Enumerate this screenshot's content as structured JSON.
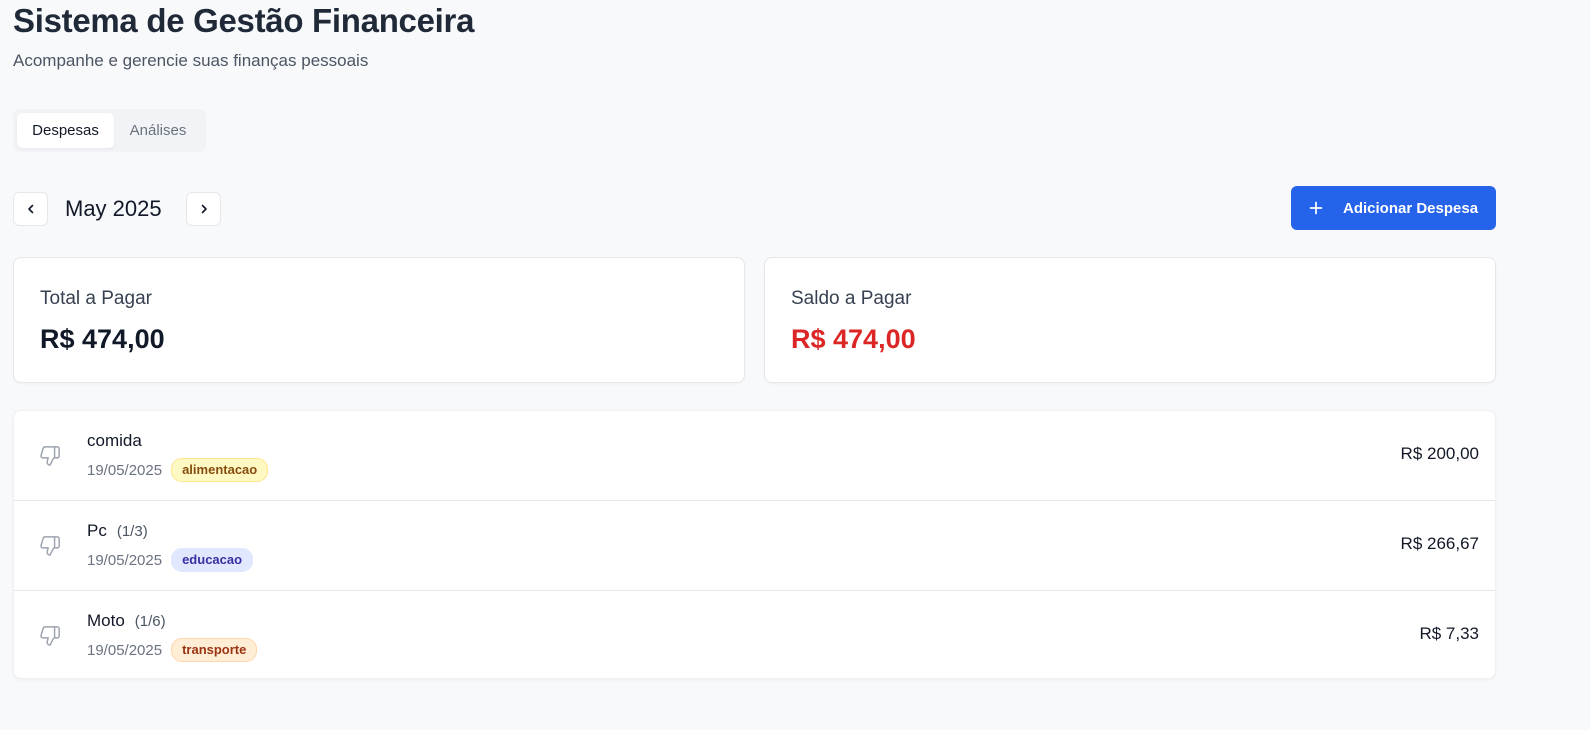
{
  "header": {
    "title": "Sistema de Gestão Financeira",
    "subtitle": "Acompanhe e gerencie suas finanças pessoais"
  },
  "tabs": [
    {
      "label": "Despesas",
      "active": true
    },
    {
      "label": "Análises",
      "active": false
    }
  ],
  "month_nav": {
    "label": "May 2025",
    "prev_icon": "chevron-left-icon",
    "next_icon": "chevron-right-icon"
  },
  "add_button": {
    "label": "Adicionar Despesa",
    "icon": "plus-icon"
  },
  "summary": {
    "total": {
      "title": "Total a Pagar",
      "value": "R$ 474,00",
      "color": "#111827"
    },
    "balance": {
      "title": "Saldo a Pagar",
      "value": "R$ 474,00",
      "color": "#dc2626"
    }
  },
  "expenses": [
    {
      "name": "comida",
      "installment": "",
      "date": "19/05/2025",
      "category": "alimentacao",
      "amount": "R$ 200,00",
      "icon": "thumbs-down-icon",
      "badge_bg": "#fef9c3",
      "badge_border": "#fde68a",
      "badge_color": "#854d0e"
    },
    {
      "name": "Pc",
      "installment": "(1/3)",
      "date": "19/05/2025",
      "category": "educacao",
      "amount": "R$ 266,67",
      "icon": "thumbs-down-icon",
      "badge_bg": "#e0e7ff",
      "badge_border": "#e0e7ff",
      "badge_color": "#3730a3"
    },
    {
      "name": "Moto",
      "installment": "(1/6)",
      "date": "19/05/2025",
      "category": "transporte",
      "amount": "R$ 7,33",
      "icon": "thumbs-down-icon",
      "badge_bg": "#ffedd5",
      "badge_border": "#fed7aa",
      "badge_color": "#9a3412"
    }
  ],
  "colors": {
    "accent": "#2563eb",
    "negative": "#dc2626"
  }
}
